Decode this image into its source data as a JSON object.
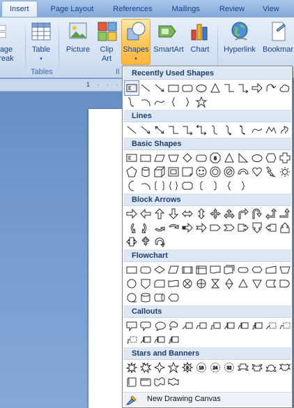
{
  "tabs": [
    "Insert",
    "Page Layout",
    "References",
    "Mailings",
    "Review",
    "View"
  ],
  "ribbon": {
    "page_break": [
      "age",
      "reak"
    ],
    "table": "Table",
    "picture": "Picture",
    "clip_art": [
      "Clip",
      "Art"
    ],
    "shapes": "Shapes",
    "smartart": "SmartArt",
    "chart": "Chart",
    "hyperlink": "Hyperlink",
    "bookmark": "Bookmar",
    "tables_group": "Tables",
    "illus_group": "Il"
  },
  "ruler": "1 · · ·",
  "gallery": {
    "recently_used": "Recently Used Shapes",
    "lines": "Lines",
    "basic_shapes": "Basic Shapes",
    "block_arrows": "Block Arrows",
    "flowchart": "Flowchart",
    "callouts": "Callouts",
    "stars_banners": "Stars and Banners",
    "new_canvas": "New Drawing Canvas"
  }
}
